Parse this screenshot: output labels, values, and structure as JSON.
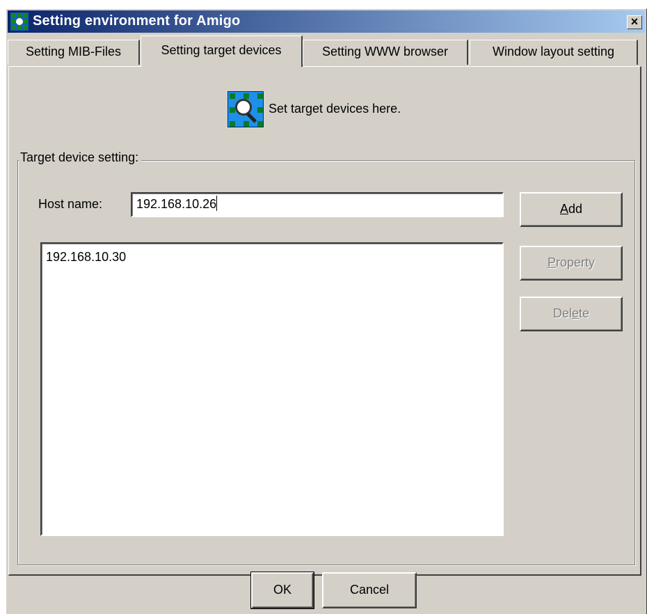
{
  "window": {
    "title": "Setting environment for Amigo",
    "close_label": "×",
    "app_icon": "network-grid-icon"
  },
  "tabs": [
    {
      "label": "Setting MIB-Files",
      "active": false
    },
    {
      "label": "Setting target devices",
      "active": true
    },
    {
      "label": "Setting WWW browser",
      "active": false
    },
    {
      "label": "Window layout setting",
      "active": false
    }
  ],
  "panel": {
    "banner_icon": "device-search-icon",
    "banner_text": "Set target devices here."
  },
  "group": {
    "legend": "Target device setting:",
    "host_label": "Host name:",
    "host_value": "192.168.10.26",
    "devices": [
      "192.168.10.30"
    ],
    "add_button": {
      "pre": "",
      "key": "A",
      "post": "dd"
    },
    "property_button": {
      "pre": "",
      "key": "P",
      "post": "roperty",
      "enabled": false
    },
    "delete_button": {
      "pre": "Del",
      "key": "e",
      "post": "te",
      "enabled": false
    }
  },
  "footer": {
    "ok_label": "OK",
    "cancel_label": "Cancel"
  }
}
